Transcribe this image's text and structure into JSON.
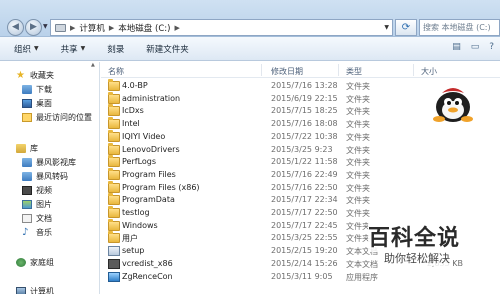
{
  "address": {
    "crumbs": [
      "计算机",
      "本地磁盘 (C:)"
    ],
    "search_placeholder": "搜索 本地磁盘 (C:)"
  },
  "toolbar": {
    "organize": "组织",
    "share": "共享",
    "burn": "刻录",
    "new_folder": "新建文件夹"
  },
  "navpane": {
    "favorites": "收藏夹",
    "downloads": "下载",
    "desktop": "桌面",
    "recent": "最近访问的位置",
    "libraries": "库",
    "lib_baofeng_video": "暴风影视库",
    "lib_baofeng_convert": "暴风转码",
    "lib_video": "视频",
    "lib_pictures": "图片",
    "lib_documents": "文档",
    "lib_music": "音乐",
    "homegroup": "家庭组",
    "computer": "计算机"
  },
  "columns": {
    "name": "名称",
    "date": "修改日期",
    "type": "类型",
    "size": "大小"
  },
  "files": [
    {
      "name": "4.0-BP",
      "date": "2015/7/16 13:28",
      "type": "文件夹",
      "size": "",
      "icon": "folder"
    },
    {
      "name": "administration",
      "date": "2015/6/19 22:15",
      "type": "文件夹",
      "size": "",
      "icon": "folder"
    },
    {
      "name": "IcDxs",
      "date": "2015/7/15 18:25",
      "type": "文件夹",
      "size": "",
      "icon": "folder"
    },
    {
      "name": "Intel",
      "date": "2015/7/16 18:08",
      "type": "文件夹",
      "size": "",
      "icon": "folder"
    },
    {
      "name": "IQIYI Video",
      "date": "2015/7/22 10:38",
      "type": "文件夹",
      "size": "",
      "icon": "folder"
    },
    {
      "name": "LenovoDrivers",
      "date": "2015/3/25 9:23",
      "type": "文件夹",
      "size": "",
      "icon": "folder"
    },
    {
      "name": "PerfLogs",
      "date": "2015/1/22 11:58",
      "type": "文件夹",
      "size": "",
      "icon": "folder"
    },
    {
      "name": "Program Files",
      "date": "2015/7/16 22:49",
      "type": "文件夹",
      "size": "",
      "icon": "folder"
    },
    {
      "name": "Program Files (x86)",
      "date": "2015/7/16 22:50",
      "type": "文件夹",
      "size": "",
      "icon": "folder"
    },
    {
      "name": "ProgramData",
      "date": "2015/7/17 22:34",
      "type": "文件夹",
      "size": "",
      "icon": "folder"
    },
    {
      "name": "testlog",
      "date": "2015/7/17 22:50",
      "type": "文件夹",
      "size": "",
      "icon": "folder"
    },
    {
      "name": "Windows",
      "date": "2015/7/17 22:45",
      "type": "文件夹",
      "size": "",
      "icon": "folder"
    },
    {
      "name": "用户",
      "date": "2015/3/25 22:55",
      "type": "文件夹",
      "size": "",
      "icon": "folder"
    },
    {
      "name": "setup",
      "date": "2015/2/15 19:20",
      "type": "文本文档",
      "size": "",
      "icon": "exe"
    },
    {
      "name": "vcredist_x86",
      "date": "2015/2/14 15:26",
      "type": "文本文档",
      "size": "2,835 KB",
      "icon": "exe2"
    },
    {
      "name": "ZgRenceCon",
      "date": "2015/3/11 9:05",
      "type": "应用程序",
      "size": "",
      "icon": "exe3"
    }
  ],
  "watermark": {
    "title": "百科全说",
    "subtitle": "助你轻松解决"
  },
  "colors": {
    "accent": "#2f6fb0",
    "toolbar_bg": "#dde8f4",
    "folder": "#e9b83e"
  }
}
